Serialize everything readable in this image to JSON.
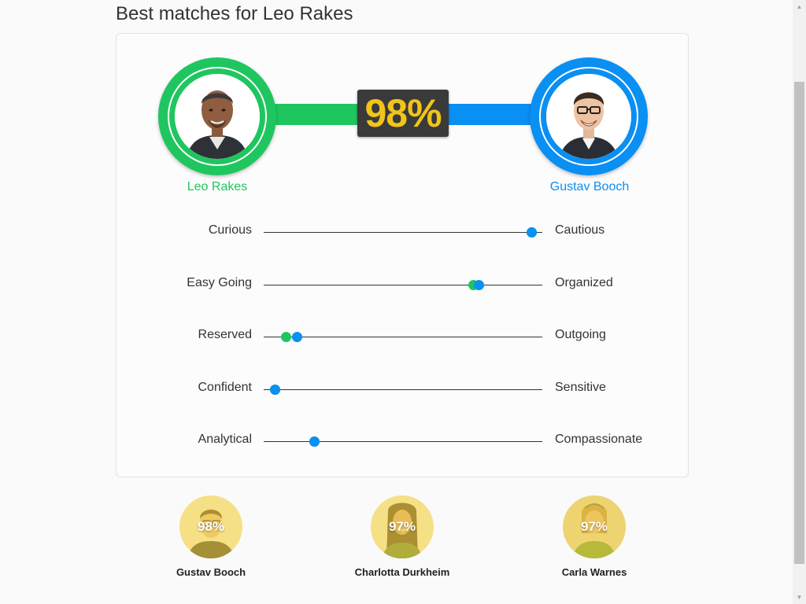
{
  "page": {
    "title": "Best matches for Leo Rakes"
  },
  "primary": {
    "name": "Leo Rakes",
    "color": "#1fc65f"
  },
  "match": {
    "name": "Gustav Booch",
    "percent": "98%",
    "color": "#0a8ff2"
  },
  "traits": [
    {
      "left": "Curious",
      "right": "Cautious",
      "leo_value": 0.96,
      "match_value": 0.96
    },
    {
      "left": "Easy Going",
      "right": "Organized",
      "leo_value": 0.75,
      "match_value": 0.77
    },
    {
      "left": "Reserved",
      "right": "Outgoing",
      "leo_value": 0.08,
      "match_value": 0.12
    },
    {
      "left": "Confident",
      "right": "Sensitive",
      "leo_value": 0.04,
      "match_value": 0.04
    },
    {
      "left": "Analytical",
      "right": "Compassionate",
      "leo_value": 0.18,
      "match_value": 0.18
    }
  ],
  "other_matches": [
    {
      "percent": "98%",
      "name": "Gustav Booch"
    },
    {
      "percent": "97%",
      "name": "Charlotta Durkheim"
    },
    {
      "percent": "97%",
      "name": "Carla Warnes"
    }
  ],
  "colors": {
    "accent_green": "#1fc65f",
    "accent_blue": "#0a8ff2",
    "percent_text": "#f0c419",
    "percent_box": "#3a3a3a",
    "match_tint": "#f0cd3c"
  },
  "icons": {
    "scroll_up": "triangle-up-icon",
    "scroll_down": "triangle-down-icon"
  }
}
